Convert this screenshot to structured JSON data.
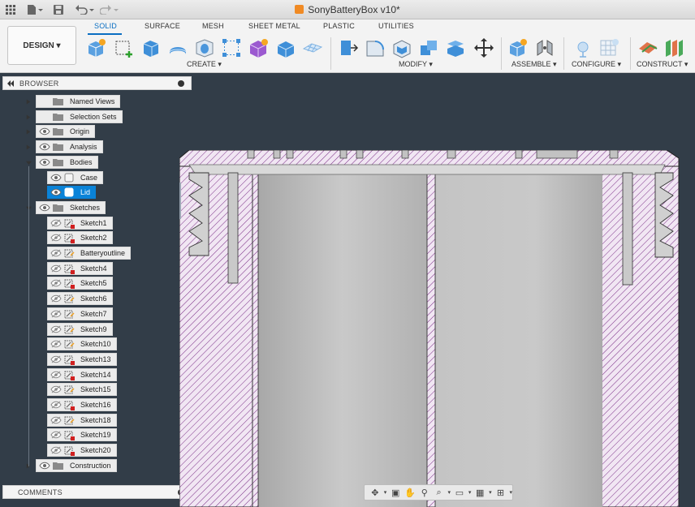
{
  "window": {
    "title": "SonyBatteryBox v10*"
  },
  "ribbon": {
    "workspace_label": "DESIGN ▾",
    "tabs": [
      "SOLID",
      "SURFACE",
      "MESH",
      "SHEET METAL",
      "PLASTIC",
      "UTILITIES"
    ],
    "active_tab": "SOLID",
    "groups": [
      {
        "label": "CREATE ▾"
      },
      {
        "label": "MODIFY ▾"
      },
      {
        "label": "ASSEMBLE ▾"
      },
      {
        "label": "CONFIGURE ▾"
      },
      {
        "label": "CONSTRUCT ▾"
      }
    ]
  },
  "browser": {
    "title": "BROWSER",
    "nodes": [
      {
        "label": "Named Views",
        "type": "folder",
        "visible": false
      },
      {
        "label": "Selection Sets",
        "type": "folder",
        "visible": false
      },
      {
        "label": "Origin",
        "type": "folder",
        "visible": true
      },
      {
        "label": "Analysis",
        "type": "folder",
        "visible": true
      },
      {
        "label": "Bodies",
        "type": "folder",
        "visible": true
      },
      {
        "label": "Case",
        "type": "body",
        "visible": true
      },
      {
        "label": "Lid",
        "type": "body",
        "visible": true,
        "selected": true
      },
      {
        "label": "Sketches",
        "type": "folder",
        "visible": true
      },
      {
        "label": "Sketch1",
        "type": "sketch",
        "visible": false
      },
      {
        "label": "Sketch2",
        "type": "sketch",
        "visible": false
      },
      {
        "label": "Batteryoutline",
        "type": "sketch",
        "visible": false
      },
      {
        "label": "Sketch4",
        "type": "sketch",
        "visible": false
      },
      {
        "label": "Sketch5",
        "type": "sketch",
        "visible": false
      },
      {
        "label": "Sketch6",
        "type": "sketch",
        "visible": false
      },
      {
        "label": "Sketch7",
        "type": "sketch",
        "visible": false
      },
      {
        "label": "Sketch9",
        "type": "sketch",
        "visible": false
      },
      {
        "label": "Sketch10",
        "type": "sketch",
        "visible": false
      },
      {
        "label": "Sketch13",
        "type": "sketch",
        "visible": false
      },
      {
        "label": "Sketch14",
        "type": "sketch",
        "visible": false
      },
      {
        "label": "Sketch15",
        "type": "sketch",
        "visible": false
      },
      {
        "label": "Sketch16",
        "type": "sketch",
        "visible": false
      },
      {
        "label": "Sketch18",
        "type": "sketch",
        "visible": false
      },
      {
        "label": "Sketch19",
        "type": "sketch",
        "visible": false
      },
      {
        "label": "Sketch20",
        "type": "sketch",
        "visible": false
      },
      {
        "label": "Construction",
        "type": "folder",
        "visible": true
      }
    ]
  },
  "comments": {
    "title": "COMMENTS"
  },
  "colors": {
    "accent": "#0a6ec2",
    "selected": "#0a83d8",
    "viewport_bg": "#323d48",
    "section_fill": "#f1e6f3",
    "section_hatch": "#7a2d86",
    "body_gray": "#b9b9b9"
  }
}
